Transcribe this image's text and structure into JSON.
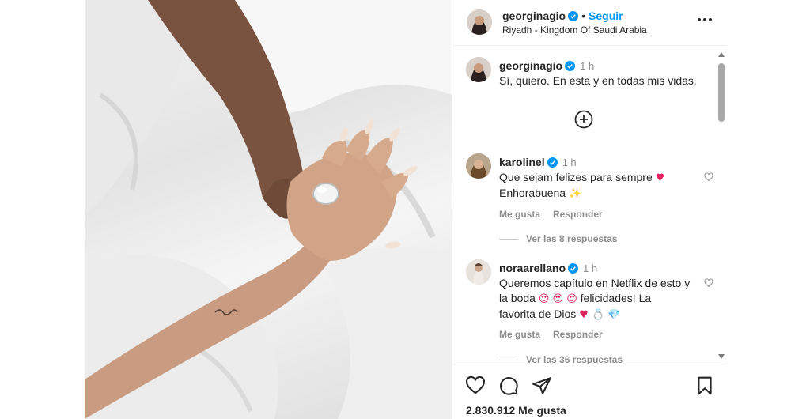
{
  "post": {
    "author": "georginagio",
    "follow_label": "Seguir",
    "location": "Riyadh - Kingdom Of Saudi Arabia",
    "caption": {
      "username": "georginagio",
      "time": "1 h",
      "text": "Sí, quiero. En esta y en todas mis vidas."
    },
    "likes_text": "2.830.912 Me gusta"
  },
  "comments": [
    {
      "username": "karolinel",
      "time": "1 h",
      "line1": "Que sejam felizes para sempre",
      "line1_emoji": "♥",
      "line2": "Enhorabuena",
      "line2_emoji": "✨",
      "like_label": "Me gusta",
      "reply_label": "Responder",
      "replies_label": "Ver las 8 respuestas"
    },
    {
      "username": "noraarellano",
      "time": "1 h",
      "line1": "Queremos capítulo en Netflix de esto y",
      "line2": "la boda",
      "line2_emojis": "😍 😍 😍",
      "line2_tail": "felicidades! La",
      "line3": "favorita de Dios",
      "line3_emojis": "♥  💍  💎",
      "like_label": "Me gusta",
      "reply_label": "Responder",
      "replies_label": "Ver las 36 respuestas"
    }
  ],
  "icons": {
    "more": "more-options-icon",
    "add_comment": "plus-circle-icon",
    "like": "heart-icon",
    "comment": "comment-icon",
    "share": "share-icon",
    "save": "bookmark-icon",
    "verified": "verified-badge-icon"
  },
  "colors": {
    "accent": "#0095f6",
    "text": "#262626",
    "muted": "#8e8e8e",
    "heart": "#e0245e"
  }
}
